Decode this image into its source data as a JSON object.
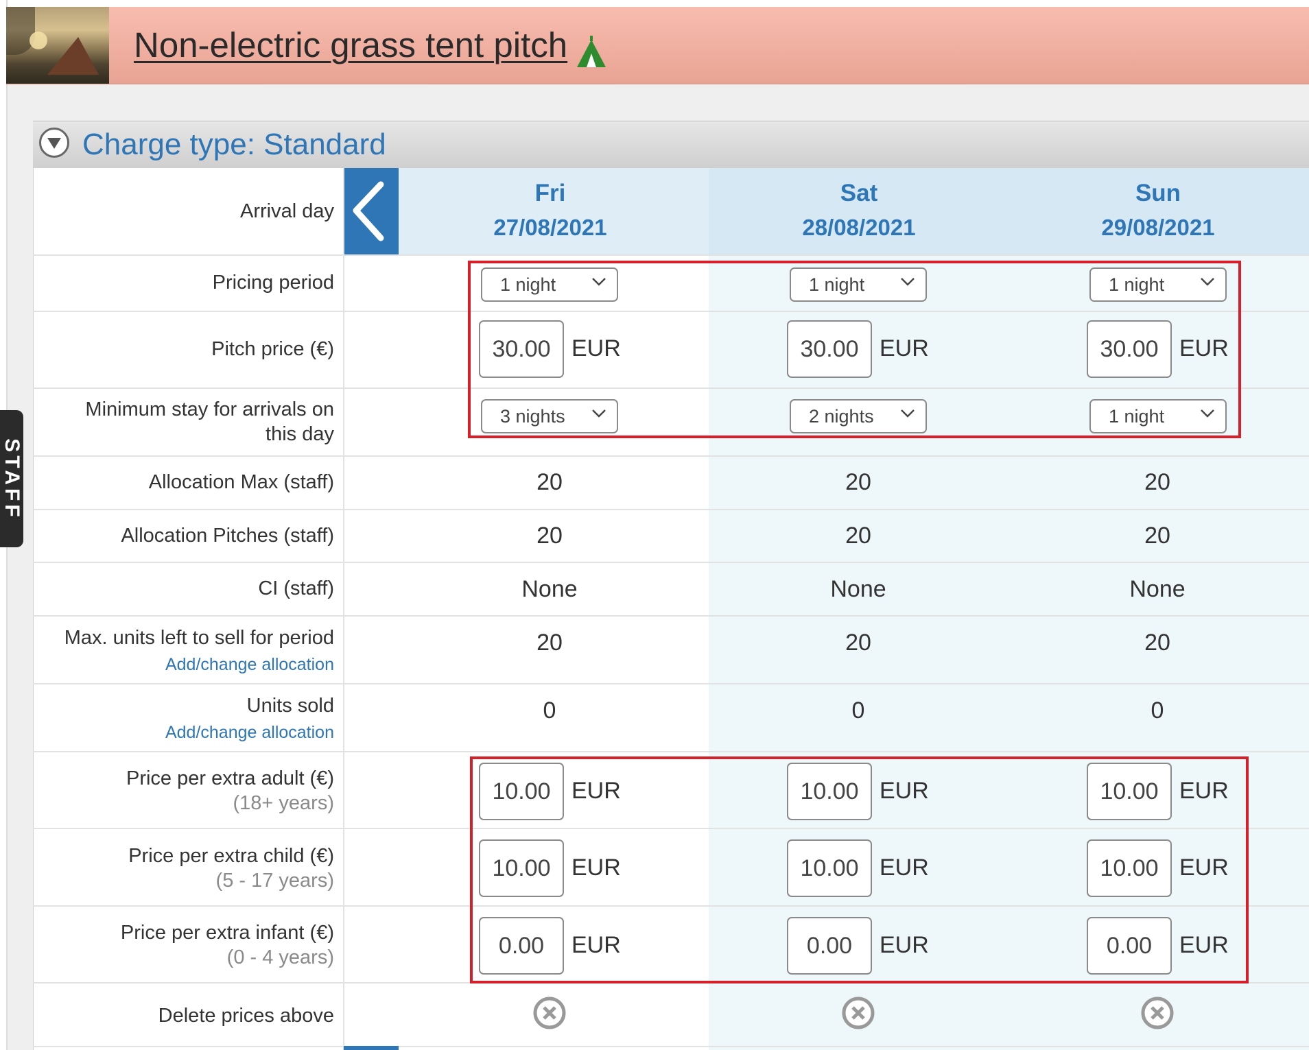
{
  "header": {
    "title": "Non-electric grass tent pitch",
    "thumbnail": "campsite-photo",
    "title_icon": "tent-icon"
  },
  "staff_tab": {
    "label": "STAFF"
  },
  "charge": {
    "title": "Charge type: Standard",
    "toggle_icon": "collapse-toggle-icon"
  },
  "rows": {
    "arrival_day": "Arrival day",
    "pricing_period": "Pricing period",
    "pitch_price": "Pitch price (€)",
    "min_stay": "Minimum stay for arrivals on this day",
    "alloc_max": "Allocation Max (staff)",
    "alloc_pitches": "Allocation Pitches (staff)",
    "ci": "CI (staff)",
    "max_units": "Max. units left to sell for period",
    "units_sold": "Units sold",
    "add_change_link": "Add/change allocation",
    "extra_adult": "Price per extra adult (€)",
    "extra_adult_sub": "(18+ years)",
    "extra_child": "Price per extra child (€)",
    "extra_child_sub": "(5 - 17 years)",
    "extra_infant": "Price per extra infant (€)",
    "extra_infant_sub": "(0 - 4 years)",
    "delete": "Delete prices above"
  },
  "currency": "EUR",
  "days": [
    {
      "name": "Fri",
      "date": "27/08/2021",
      "pricing_period": "1 night",
      "pitch_price": "30.00",
      "min_stay": "3 nights",
      "alloc_max": "20",
      "alloc_pitches": "20",
      "ci": "None",
      "max_units": "20",
      "units_sold": "0",
      "extra_adult": "10.00",
      "extra_child": "10.00",
      "extra_infant": "0.00"
    },
    {
      "name": "Sat",
      "date": "28/08/2021",
      "pricing_period": "1 night",
      "pitch_price": "30.00",
      "min_stay": "2 nights",
      "alloc_max": "20",
      "alloc_pitches": "20",
      "ci": "None",
      "max_units": "20",
      "units_sold": "0",
      "extra_adult": "10.00",
      "extra_child": "10.00",
      "extra_infant": "0.00"
    },
    {
      "name": "Sun",
      "date": "29/08/2021",
      "pricing_period": "1 night",
      "pitch_price": "30.00",
      "min_stay": "1 night",
      "alloc_max": "20",
      "alloc_pitches": "20",
      "ci": "None",
      "max_units": "20",
      "units_sold": "0",
      "extra_adult": "10.00",
      "extra_child": "10.00",
      "extra_infant": "0.00"
    }
  ],
  "colors": {
    "accent": "#2e76b6",
    "highlight": "#d3202b",
    "header": "#f4b0a2",
    "tent": "#2e8b2e"
  }
}
